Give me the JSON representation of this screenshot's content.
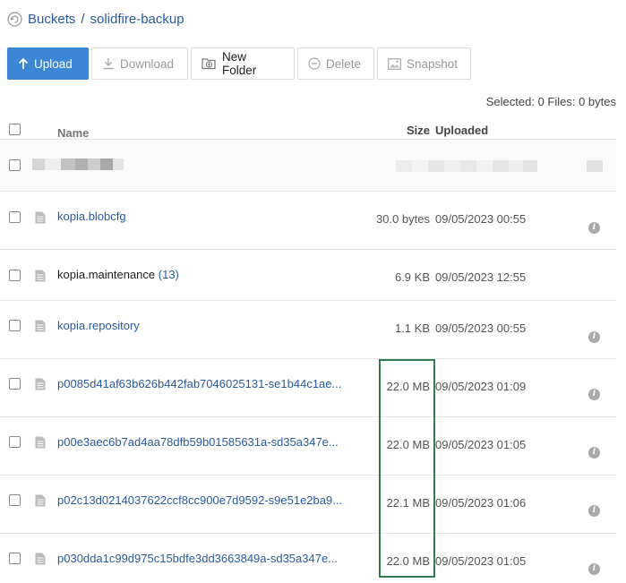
{
  "breadcrumb": {
    "root": "Buckets",
    "separator": "/",
    "bucket": "solidfire-backup"
  },
  "toolbar": {
    "upload": "Upload",
    "download": "Download",
    "new_folder": "New Folder",
    "delete": "Delete",
    "snapshot": "Snapshot"
  },
  "selection_info": "Selected: 0 Files: 0 bytes",
  "columns": {
    "name": "Name",
    "size": "Size",
    "uploaded": "Uploaded"
  },
  "files": [
    {
      "name": "kopia.blobcfg",
      "size": "30.0 bytes",
      "uploaded": "09/05/2023 00:55"
    },
    {
      "name": "kopia.maintenance",
      "count": "(13)",
      "size": "6.9 KB",
      "uploaded": "09/05/2023 12:55"
    },
    {
      "name": "kopia.repository",
      "size": "1.1 KB",
      "uploaded": "09/05/2023 00:55"
    },
    {
      "name": "p0085d41af63b626b442fab7046025131-se1b44c1ae...",
      "size": "22.0 MB",
      "uploaded": "09/05/2023 01:09"
    },
    {
      "name": "p00e3aec6b7ad4aa78dfb59b01585631a-sd35a347e...",
      "size": "22.0 MB",
      "uploaded": "09/05/2023 01:05"
    },
    {
      "name": "p02c13d0214037622ccf8cc900e7d9592-s9e51e2ba9...",
      "size": "22.1 MB",
      "uploaded": "09/05/2023 01:06"
    },
    {
      "name": "p030dda1c99d975c15bdfe3dd3663849a-sd35a347e...",
      "size": "22.0 MB",
      "uploaded": "09/05/2023 01:05"
    }
  ],
  "colors": {
    "link": "#2c5aa0",
    "primary": "#3b87d6",
    "highlight": "#2e7d4f"
  }
}
